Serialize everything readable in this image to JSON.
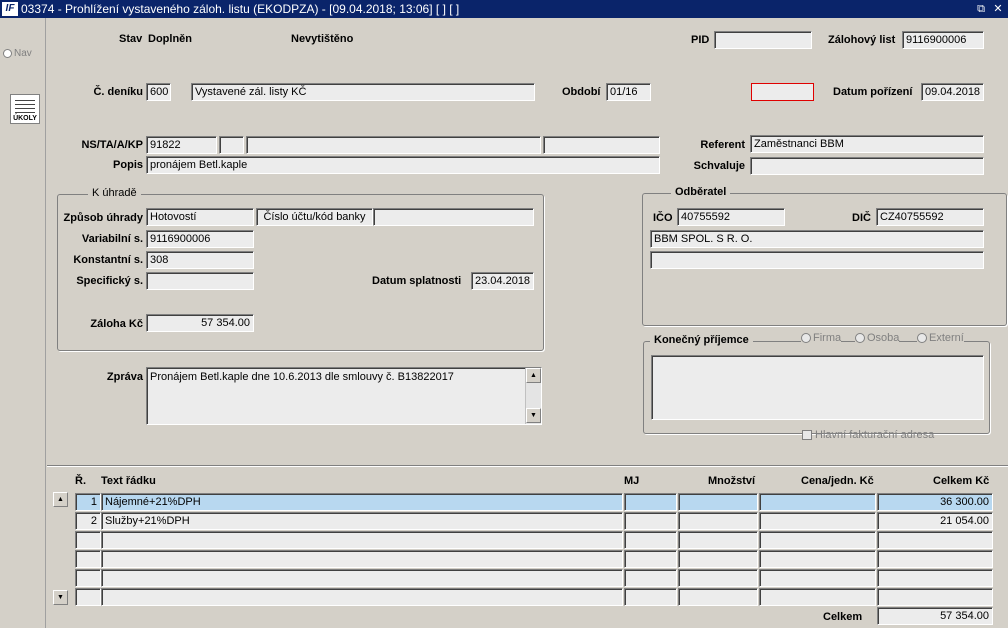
{
  "window": {
    "title": "03374 - Prohlížení vystaveného záloh. listu (EKODPZA) - [09.04.2018; 13:06] [ ] [ ]"
  },
  "sidebar": {
    "nav_label": "Nav",
    "ukoly_label": "ÚKOLY"
  },
  "header": {
    "stav_label": "Stav",
    "stav_value": "Doplněn",
    "tisk_value": "Nevytištěno",
    "pid_label": "PID",
    "pid_value": "",
    "zalohovy_list_label": "Zálohový list",
    "zalohovy_list_value": "9116900006"
  },
  "denik": {
    "label": "Č. deníku",
    "code": "600",
    "name": "Vystavené zál. listy KČ",
    "obdobi_label": "Období",
    "obdobi_value": "01/16",
    "red_field_value": "",
    "datum_porizeni_label": "Datum pořízení",
    "datum_porizeni_value": "09.04.2018"
  },
  "ns": {
    "label": "NS/TA/A/KP",
    "v1": "91822",
    "v2": "",
    "v3": "",
    "v4": "",
    "popis_label": "Popis",
    "popis_value": "pronájem Betl.kaple",
    "referent_label": "Referent",
    "referent_value": "Zaměstnanci BBM",
    "schvaluje_label": "Schvaluje",
    "schvaluje_value": ""
  },
  "k_uhrade": {
    "caption": "K úhradě",
    "zpusob_label": "Způsob úhrady",
    "zpusob_value": "Hotovostí",
    "cislo_uctu_label": "Číslo účtu/kód banky",
    "cislo_uctu_value": "",
    "variabilni_label": "Variabilní s.",
    "variabilni_value": "9116900006",
    "konstantni_label": "Konstantní s.",
    "konstantni_value": "308",
    "specificky_label": "Specifický s.",
    "specificky_value": "",
    "splatnost_label": "Datum splatnosti",
    "splatnost_value": "23.04.2018",
    "zaloha_label": "Záloha Kč",
    "zaloha_value": "57 354.00"
  },
  "odberatel": {
    "caption": "Odběratel",
    "ico_label": "IČO",
    "ico_value": "40755592",
    "dic_label": "DIČ",
    "dic_value": "CZ40755592",
    "name_value": "BBM SPOL. S R. O.",
    "extra_value": ""
  },
  "konecny": {
    "caption": "Konečný příjemce",
    "opt_firma": "Firma",
    "opt_osoba": "Osoba",
    "opt_externi": "Externí",
    "hlavni_label": "Hlavní fakturační adresa"
  },
  "zprava": {
    "label": "Zpráva",
    "value": "Pronájem Betl.kaple dne 10.6.2013 dle smlouvy č. B13822017"
  },
  "grid": {
    "headers": {
      "r": "Ř.",
      "text": "Text řádku",
      "mj": "MJ",
      "mnozstvi": "Množství",
      "cena": "Cena/jedn. Kč",
      "celkem": "Celkem Kč"
    },
    "rows": [
      {
        "r": "1",
        "text": "Nájemné+21%DPH",
        "mj": "",
        "mnozstvi": "",
        "cena": "",
        "celkem": "36 300.00"
      },
      {
        "r": "2",
        "text": "Služby+21%DPH",
        "mj": "",
        "mnozstvi": "",
        "cena": "",
        "celkem": "21 054.00"
      },
      {
        "r": "",
        "text": "",
        "mj": "",
        "mnozstvi": "",
        "cena": "",
        "celkem": ""
      },
      {
        "r": "",
        "text": "",
        "mj": "",
        "mnozstvi": "",
        "cena": "",
        "celkem": ""
      },
      {
        "r": "",
        "text": "",
        "mj": "",
        "mnozstvi": "",
        "cena": "",
        "celkem": ""
      },
      {
        "r": "",
        "text": "",
        "mj": "",
        "mnozstvi": "",
        "cena": "",
        "celkem": ""
      }
    ],
    "total_label": "Celkem",
    "total_value": "57 354.00"
  }
}
